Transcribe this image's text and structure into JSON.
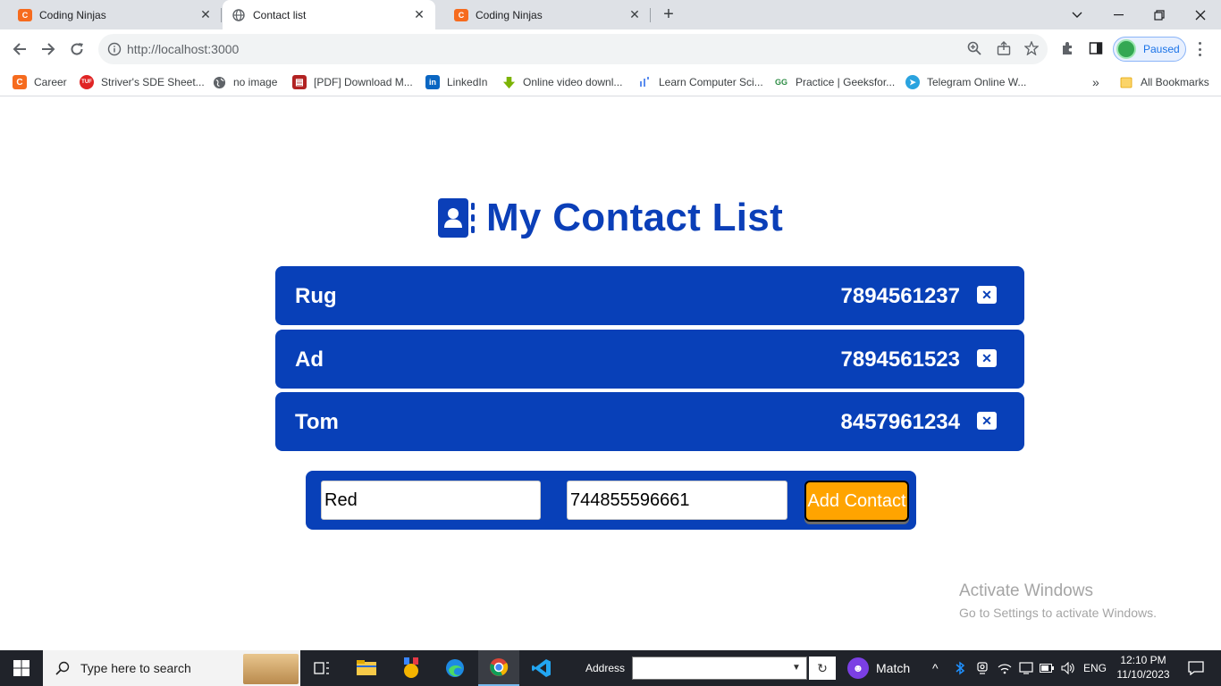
{
  "browser": {
    "tabs": [
      {
        "title": "Coding Ninjas",
        "favicon": "coding-ninjas",
        "active": false
      },
      {
        "title": "Contact list",
        "favicon": "globe",
        "active": true
      },
      {
        "title": "Coding Ninjas",
        "favicon": "coding-ninjas",
        "active": false
      }
    ],
    "url": "http://localhost:3000",
    "profile_status": "Paused",
    "bookmarks": [
      {
        "label": "Career",
        "icon": "coding-ninjas"
      },
      {
        "label": "Striver's SDE Sheet...",
        "icon": "tuf"
      },
      {
        "label": "no image",
        "icon": "globe"
      },
      {
        "label": "[PDF] Download M...",
        "icon": "pdf"
      },
      {
        "label": "LinkedIn",
        "icon": "linkedin"
      },
      {
        "label": "Online video downl...",
        "icon": "download-arrow"
      },
      {
        "label": "Learn Computer Sci...",
        "icon": "dots"
      },
      {
        "label": "Practice | Geeksfor...",
        "icon": "gfg"
      },
      {
        "label": "Telegram Online W...",
        "icon": "telegram"
      }
    ],
    "all_bookmarks": "All Bookmarks"
  },
  "app": {
    "title": "My Contact List",
    "contacts": [
      {
        "name": "Rug",
        "phone": "7894561237"
      },
      {
        "name": "Ad",
        "phone": "7894561523"
      },
      {
        "name": "Tom",
        "phone": "8457961234"
      }
    ],
    "form": {
      "name_value": "Red",
      "phone_value": "744855596661",
      "add_label": "Add Contact"
    },
    "colors": {
      "primary": "#0840b8",
      "accent": "#ffa400"
    }
  },
  "watermark": {
    "line1": "Activate Windows",
    "line2": "Go to Settings to activate Windows."
  },
  "taskbar": {
    "search_placeholder": "Type here to search",
    "address_label": "Address",
    "weather_label": "Match",
    "language": "ENG",
    "time": "12:10 PM",
    "date": "11/10/2023"
  }
}
